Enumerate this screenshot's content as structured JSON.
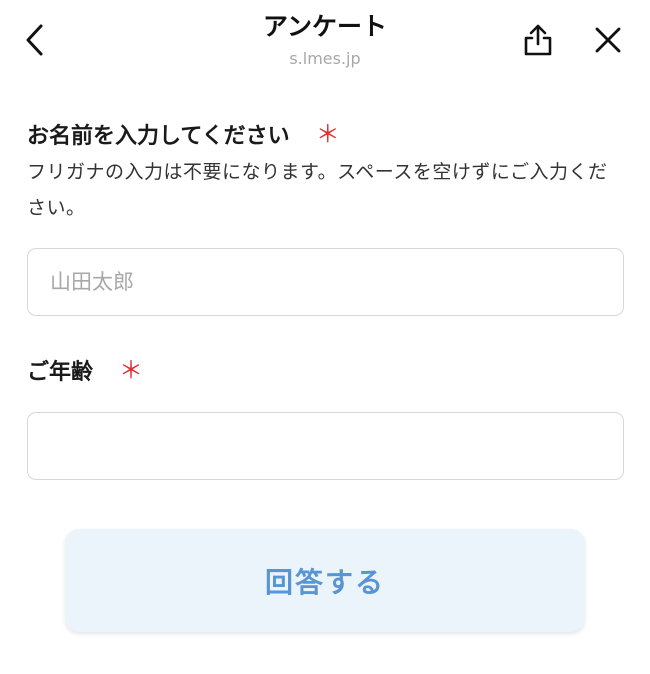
{
  "header": {
    "title": "アンケート",
    "domain": "s.lmes.jp",
    "icons": {
      "back": "chevron-left-icon",
      "share": "share-icon",
      "close": "close-icon"
    }
  },
  "form": {
    "name_field": {
      "label": "お名前を入力してください",
      "required_mark": "＊",
      "description": "フリガナの入力は不要になります。スペースを空けずにご入力ください。",
      "placeholder": "山田太郎",
      "value": ""
    },
    "age_field": {
      "label": "ご年齢",
      "required_mark": "＊",
      "placeholder": "",
      "value": ""
    },
    "submit_label": "回答する"
  },
  "colors": {
    "required": "#e0302f",
    "submit_bg": "#ebf3fb",
    "submit_text": "#5a95d3",
    "placeholder": "#a8a8a8",
    "border": "#d8d8d8"
  }
}
